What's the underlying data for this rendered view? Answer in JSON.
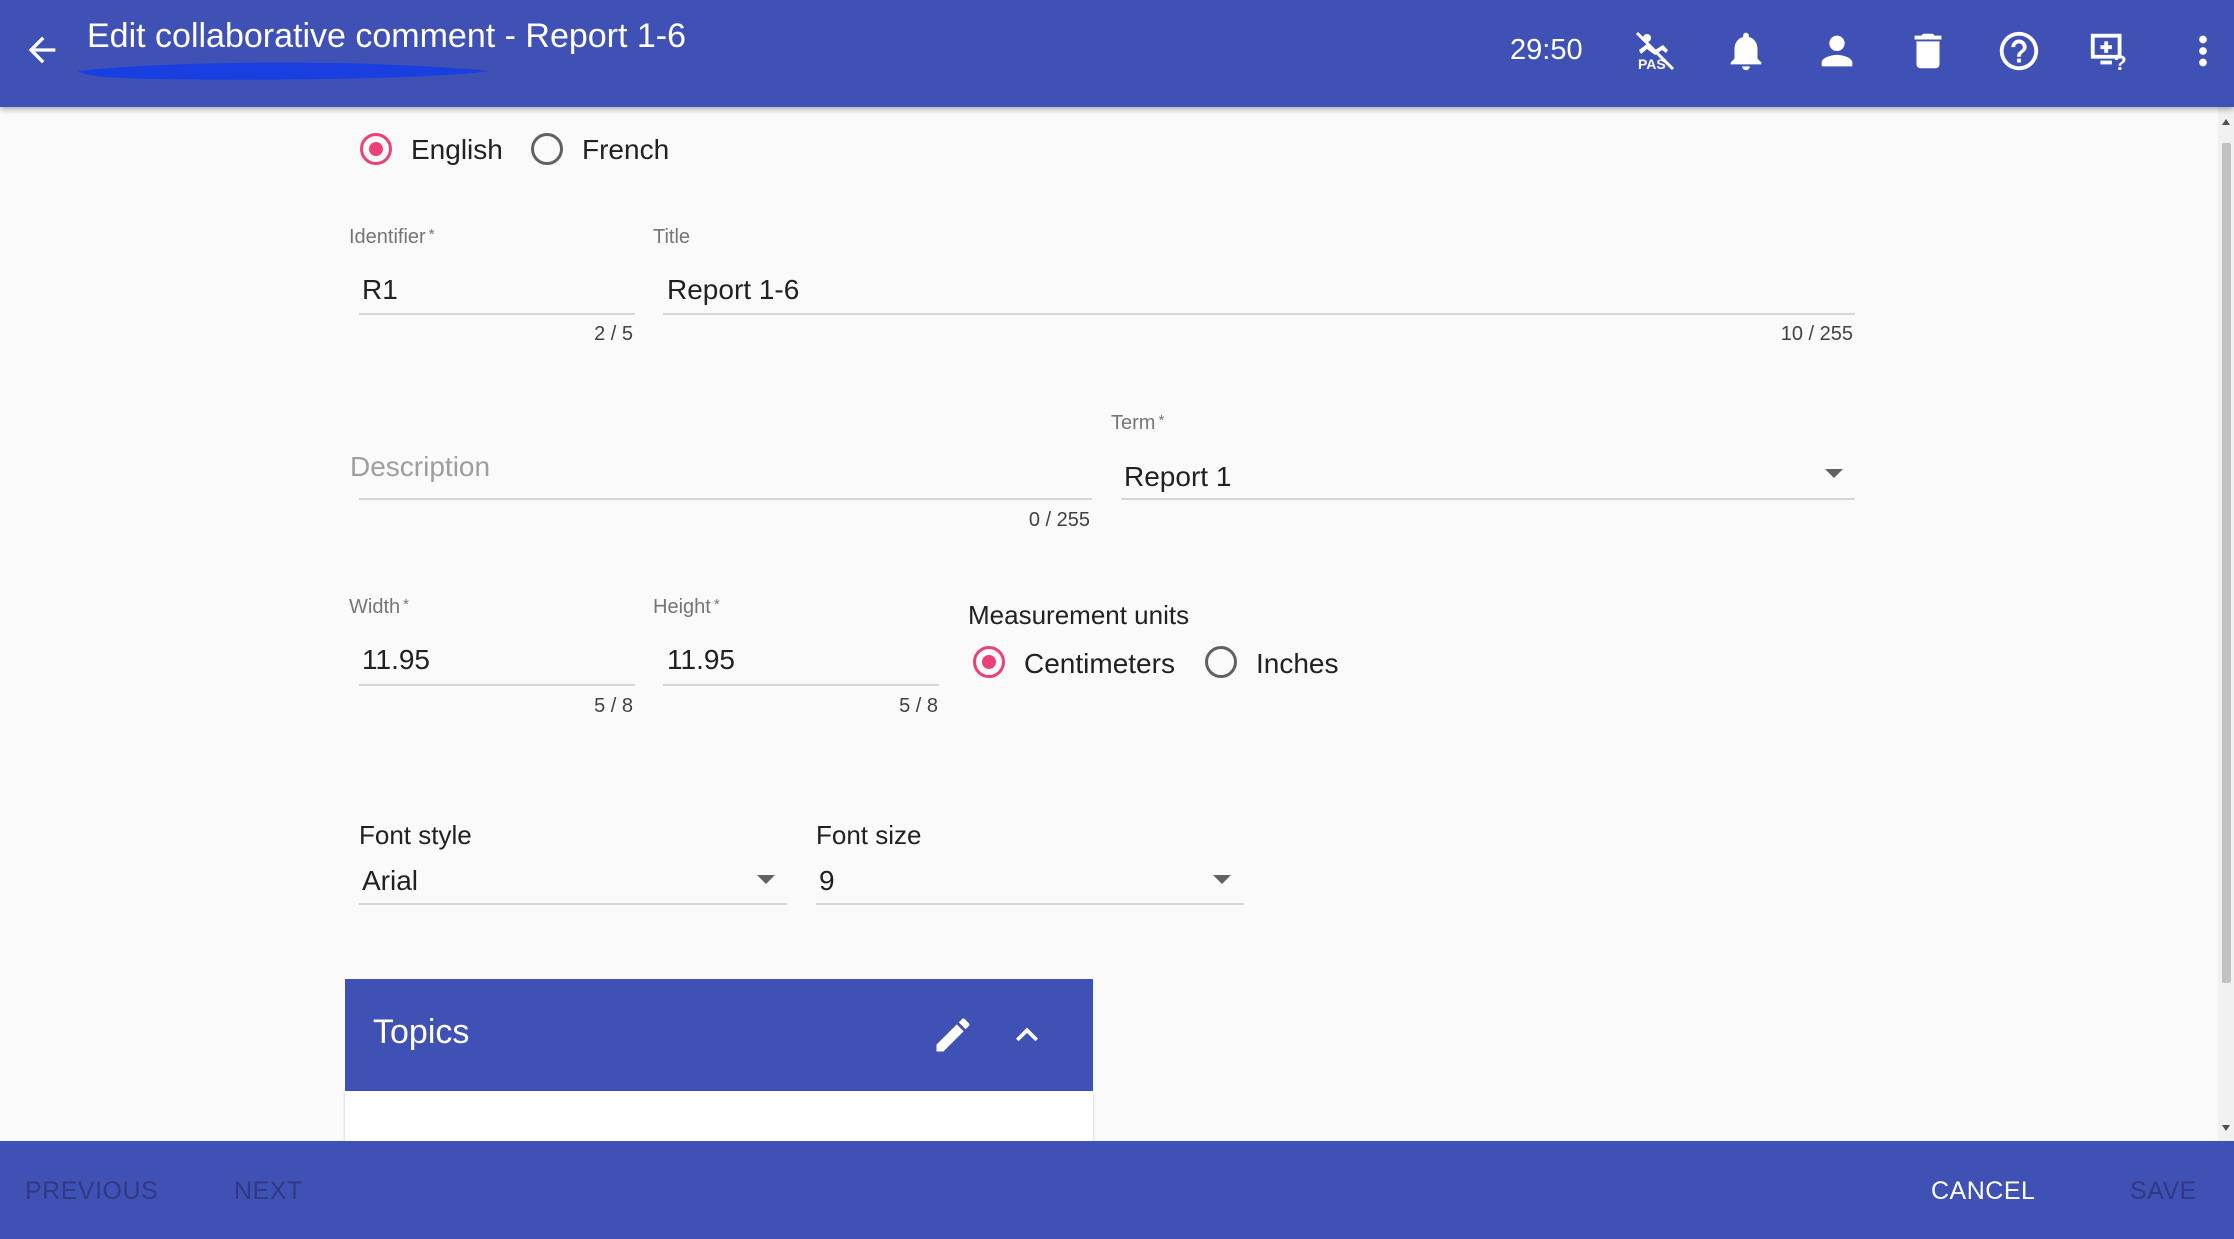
{
  "colors": {
    "primary": "#3f51b5",
    "accent": "#ec407a",
    "redaction": "#1a3fe0"
  },
  "appbar": {
    "back_icon": "arrow-back-icon",
    "title": "Edit collaborative comment - Report 1-6",
    "timer": "29:50",
    "icons": [
      "pas-off-icon",
      "bell-icon",
      "person-icon",
      "trash-icon",
      "help-icon",
      "screen-share-icon",
      "more-vert-icon"
    ]
  },
  "language": {
    "options": [
      "English",
      "French"
    ],
    "selected": "English"
  },
  "identifier": {
    "label": "Identifier",
    "required": "*",
    "value": "R1",
    "counter": "2 / 5"
  },
  "title_field": {
    "label": "Title",
    "value": "Report 1-6",
    "counter": "10 / 255"
  },
  "description": {
    "placeholder": "Description",
    "value": "",
    "counter": "0 / 255"
  },
  "term": {
    "label": "Term",
    "required": "*",
    "value": "Report 1"
  },
  "width": {
    "label": "Width",
    "required": "*",
    "value": "11.95",
    "counter": "5 / 8"
  },
  "height": {
    "label": "Height",
    "required": "*",
    "value": "11.95",
    "counter": "5 / 8"
  },
  "measurement_units": {
    "label": "Measurement units",
    "options": [
      "Centimeters",
      "Inches"
    ],
    "selected": "Centimeters"
  },
  "font_style": {
    "label": "Font style",
    "value": "Arial"
  },
  "font_size": {
    "label": "Font size",
    "value": "9"
  },
  "topics": {
    "title": "Topics",
    "icons": [
      "edit-icon",
      "chevron-up-icon"
    ]
  },
  "bottombar": {
    "previous": "PREVIOUS",
    "next": "NEXT",
    "cancel": "CANCEL",
    "save": "SAVE"
  }
}
